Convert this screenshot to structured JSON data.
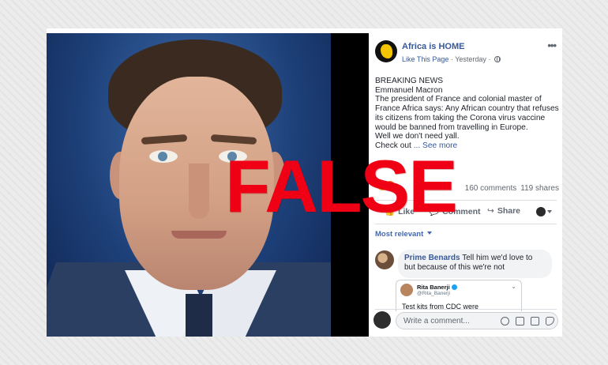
{
  "stamp": "FALSE",
  "post": {
    "page_name": "Africa is HOME",
    "like_link": "Like This Page",
    "separator": "·",
    "time": "Yesterday",
    "separator2": "·",
    "text_lines": [
      "BREAKING NEWS",
      "Emmanuel Macron",
      "The president of France and colonial master of",
      "France Africa says: Any African country that refuses",
      "its citizens from taking the Corona virus vaccine",
      "would be banned from travelling in Europe.",
      "Well we don't need yall."
    ],
    "check_out": "Check out",
    "see_more": "... See more",
    "comments_count": "160 comments",
    "shares_count": "119 shares",
    "actions": {
      "like": "Like",
      "comment": "Comment",
      "share": "Share"
    },
    "icons": {
      "like": "thumbs-up-icon",
      "comment": "comment-icon",
      "share": "share-icon",
      "more": "more-icon",
      "globe": "globe-icon"
    }
  },
  "comments": {
    "sort_label": "Most relevant",
    "items": [
      {
        "author": "Prime Benards",
        "text": "Tell him we'd love to but because of this we're not",
        "embed": {
          "name": "Rita Banerji",
          "handle": "@Rita_Banerji",
          "text": "Test kits from CDC were"
        }
      }
    ],
    "write_placeholder": "Write a comment..."
  },
  "colors": {
    "link": "#385898",
    "stamp": "#f00014",
    "muted": "#606770"
  }
}
